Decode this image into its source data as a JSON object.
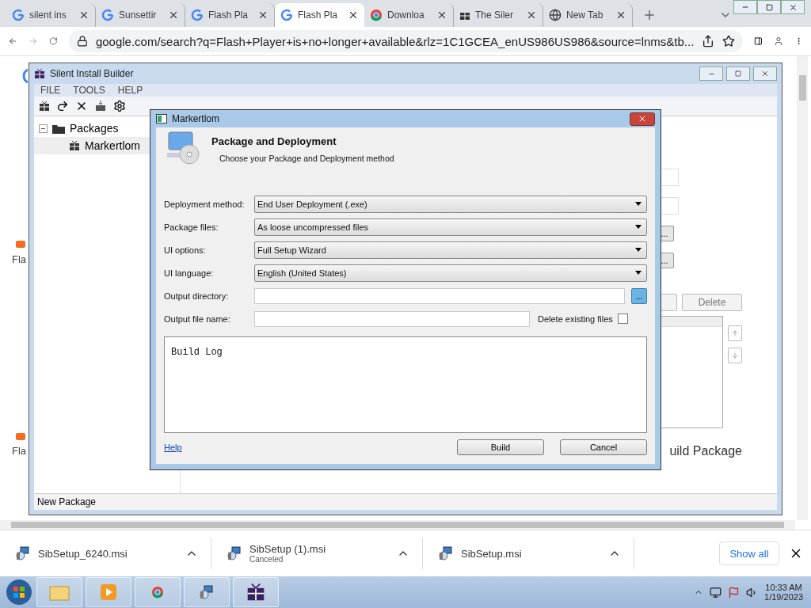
{
  "browser": {
    "tabs": [
      {
        "title": "silent ins",
        "kind": "google",
        "selected": false
      },
      {
        "title": "Sunsettir",
        "kind": "google",
        "selected": false
      },
      {
        "title": "Flash Pla",
        "kind": "google",
        "selected": false
      },
      {
        "title": "Flash Pla",
        "kind": "google",
        "selected": true
      },
      {
        "title": "Downloa",
        "kind": "chrome",
        "selected": false
      },
      {
        "title": "The Siler",
        "kind": "gift",
        "selected": false
      },
      {
        "title": "New Tab",
        "kind": "globe",
        "selected": false
      }
    ],
    "address": "google.com/search?q=Flash+Player+is+no+longer+available&rlz=1C1GCEA_enUS986US986&source=lnms&tb...",
    "page_fragments": [
      "Fla",
      "Fla"
    ],
    "downloads": [
      {
        "name": "SibSetup_6240.msi"
      },
      {
        "name": "SibSetup (1).msi",
        "status": "Canceled"
      },
      {
        "name": "SibSetup.msi"
      }
    ],
    "show_all": "Show all"
  },
  "app": {
    "title": "Silent Install Builder",
    "menu": [
      "FILE",
      "TOOLS",
      "HELP"
    ],
    "tree": [
      {
        "label": "Packages",
        "expanded": true,
        "children": [
          {
            "label": "Markertlom",
            "selected": true
          }
        ]
      }
    ],
    "browse_buttons": [
      "...",
      "..."
    ],
    "delete_button": "Delete",
    "build_text": "uild Package",
    "status": "New Package"
  },
  "dialog": {
    "title": "Markertlom",
    "heading": "Package and Deployment",
    "subheading": "Choose your Package and Deployment method",
    "fields": [
      {
        "kind": "select",
        "label": "Deployment method:",
        "value": "End User Deployment (.exe)"
      },
      {
        "kind": "select",
        "label": "Package files:",
        "value": "As loose uncompressed files"
      },
      {
        "kind": "select",
        "label": "UI options:",
        "value": "Full Setup Wizard"
      },
      {
        "kind": "select",
        "label": "UI language:",
        "value": "English (United States)"
      },
      {
        "kind": "browse",
        "label": "Output directory:",
        "button": "..."
      },
      {
        "kind": "text",
        "label": "Output file name:",
        "checkbox": {
          "label": "Delete existing files",
          "checked": false
        }
      }
    ],
    "log": "Build Log",
    "help": "Help",
    "buttons": [
      "Build",
      "Cancel"
    ]
  },
  "taskbar": {
    "time": "10:33 AM",
    "date": "1/19/2023"
  }
}
